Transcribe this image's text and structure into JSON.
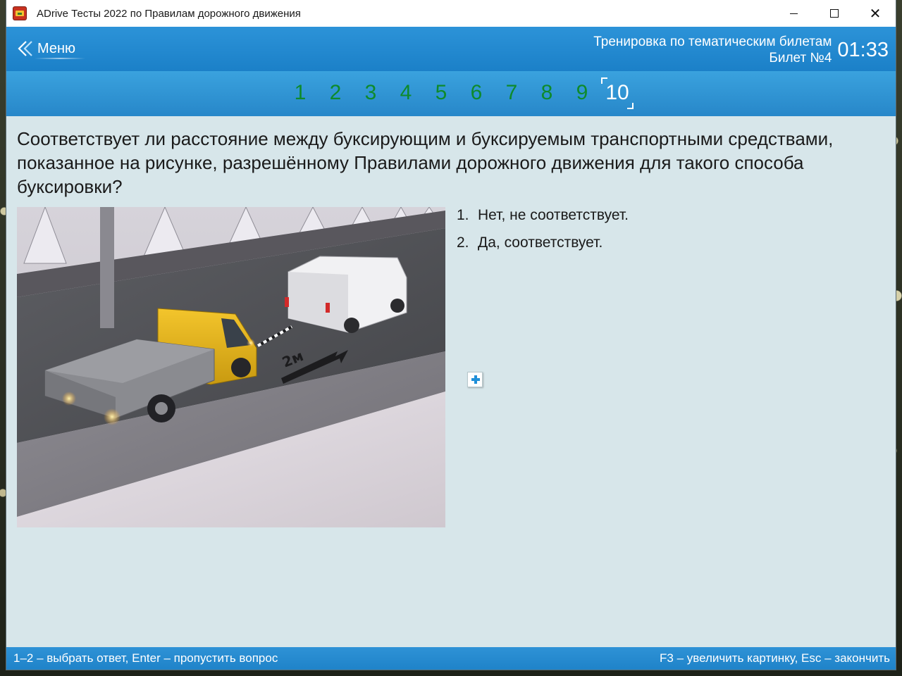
{
  "window": {
    "title": "ADrive Тесты 2022 по Правилам дорожного движения",
    "controls": {
      "minimize_icon": "minimize-icon",
      "maximize_icon": "maximize-icon",
      "close_glyph": "✕"
    }
  },
  "header": {
    "menu_label": "Меню",
    "mode_title": "Тренировка по тематическим билетам",
    "ticket_label": "Билет №4",
    "timer": "01:33"
  },
  "questions_nav": {
    "items": [
      "1",
      "2",
      "3",
      "4",
      "5",
      "6",
      "7",
      "8",
      "9",
      "10"
    ],
    "current": "10"
  },
  "question": {
    "text": "Соответствует ли расстояние между буксирующим и буксируемым транспортными средствами, показанное на рисунке, разрешённому Правилами дорожного движения для такого способа буксировки?",
    "image_label": "2м",
    "answers": [
      {
        "index": "1.",
        "text": "Нет, не соответствует."
      },
      {
        "index": "2.",
        "text": "Да, соответствует."
      }
    ]
  },
  "footer": {
    "left_hint": "1–2 – выбрать ответ, Enter – пропустить вопрос",
    "right_hint": "F3 – увеличить картинку, Esc – закончить"
  },
  "colors": {
    "header_blue": "#1f86cc",
    "nav_number_green": "#0e8a2c",
    "content_bg": "#d7e6ea"
  }
}
